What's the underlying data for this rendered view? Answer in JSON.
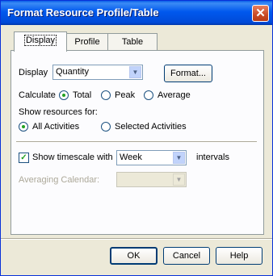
{
  "window": {
    "title": "Format Resource Profile/Table",
    "close_glyph": "✕"
  },
  "tabs": [
    {
      "label": "Display",
      "active": true
    },
    {
      "label": "Profile",
      "active": false
    },
    {
      "label": "Table",
      "active": false
    }
  ],
  "display": {
    "label": "Display",
    "value": "Quantity",
    "format_button": "Format..."
  },
  "calculate": {
    "label": "Calculate",
    "options": [
      {
        "label": "Total",
        "selected": true
      },
      {
        "label": "Peak",
        "selected": false
      },
      {
        "label": "Average",
        "selected": false
      }
    ]
  },
  "show_resources": {
    "label": "Show resources for:",
    "options": [
      {
        "label": "All Activities",
        "selected": true
      },
      {
        "label": "Selected Activities",
        "selected": false
      }
    ]
  },
  "timescale": {
    "checkbox_label": "Show timescale with",
    "checked": true,
    "value": "Week",
    "suffix": "intervals"
  },
  "averaging": {
    "label": "Averaging Calendar:",
    "value": "",
    "enabled": false
  },
  "buttons": {
    "ok": "OK",
    "cancel": "Cancel",
    "help": "Help"
  },
  "colors": {
    "title_bar": "#0058ee",
    "dialog_bg": "#ece9d8",
    "close_button": "#c84a25"
  }
}
